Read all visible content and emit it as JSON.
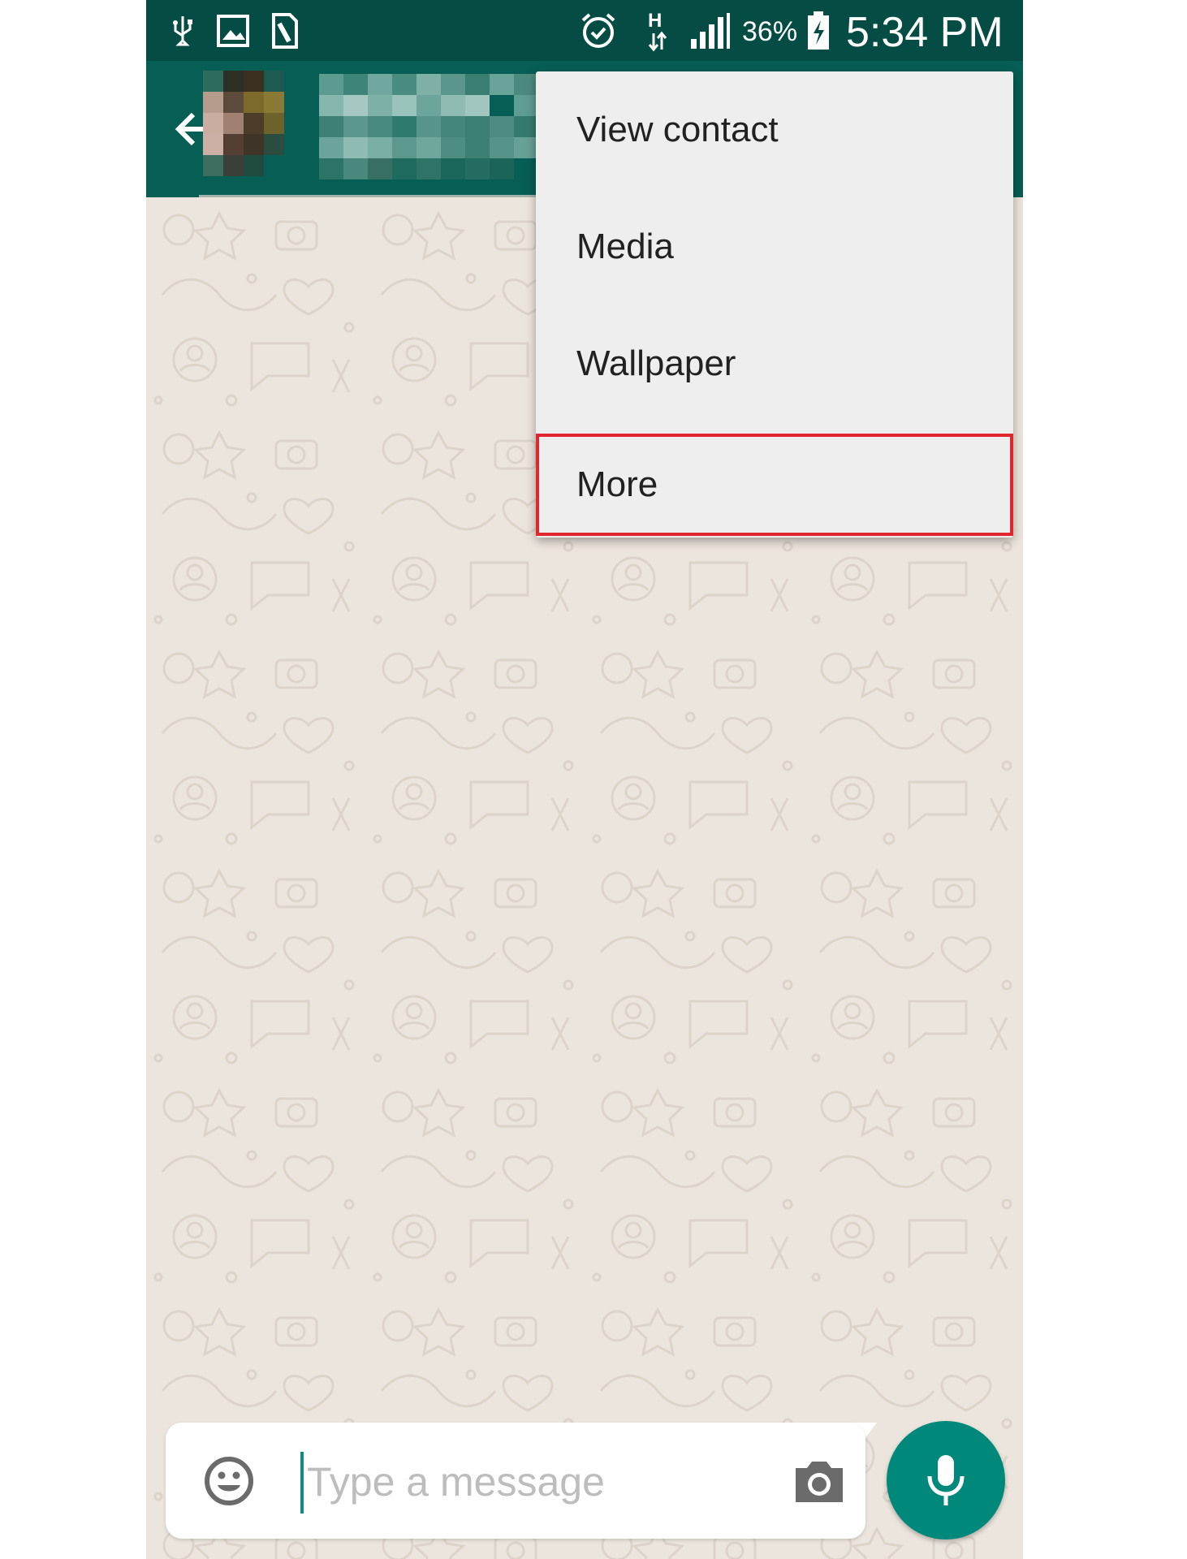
{
  "status_bar": {
    "battery_percent": "36%",
    "time": "5:34 PM",
    "network_type": "H",
    "icons": [
      "usb-icon",
      "image-icon",
      "sim-icon",
      "alarm-icon",
      "data-arrows-icon",
      "signal-icon",
      "battery-charging-icon"
    ]
  },
  "app_bar": {
    "back_icon": "arrow-back-icon",
    "contact_name_obscured": true
  },
  "overflow_menu": {
    "items": [
      {
        "label": "View contact"
      },
      {
        "label": "Media"
      },
      {
        "label": "Wallpaper"
      },
      {
        "label": "More",
        "highlighted": true
      }
    ]
  },
  "composer": {
    "placeholder": "Type a message",
    "value": "",
    "emoji_icon": "emoji-icon",
    "camera_icon": "camera-icon",
    "mic_icon": "mic-icon"
  },
  "colors": {
    "status_bar": "#054d44",
    "app_bar": "#075e54",
    "wallpaper": "#ece5dd",
    "menu_bg": "#eeeeee",
    "highlight": "#e0262f",
    "mic_button": "#00897b"
  }
}
